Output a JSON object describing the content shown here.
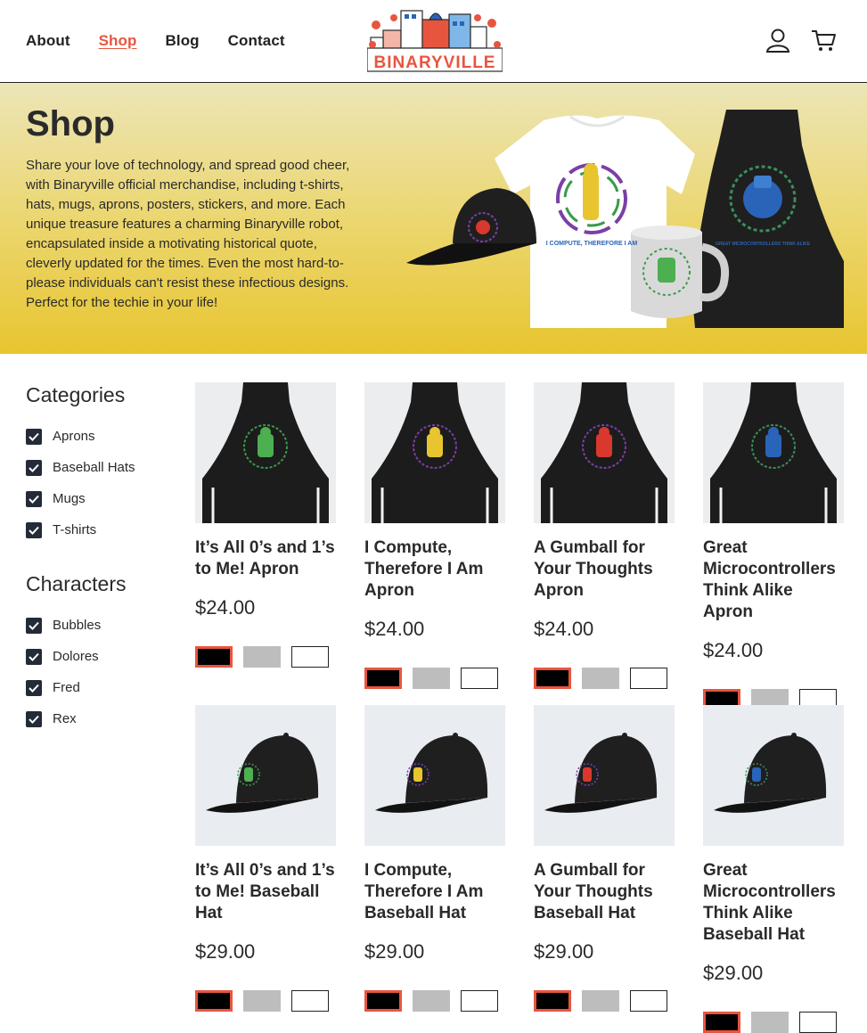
{
  "header": {
    "nav": [
      "About",
      "Shop",
      "Blog",
      "Contact"
    ],
    "active_nav": "Shop",
    "logo_text": "BINARYVILLE",
    "icons": [
      "user-icon",
      "cart-icon"
    ]
  },
  "hero": {
    "title": "Shop",
    "description": "Share your love of technology, and spread good cheer, with Binaryville official merchandise, including t-shirts, hats, mugs, aprons, posters, stickers, and more. Each unique treasure features a charming Binaryville robot, encapsulated inside a motivating historical quote, cleverly updated for the times. Even the most hard-to-please individuals can't resist these infectious designs. Perfect for the techie in your life!",
    "shirt_text": "I COMPUTE, THEREFORE I AM",
    "apron_text": "GREAT MICROCONTROLLERS THINK ALIKE"
  },
  "filters": {
    "categories_title": "Categories",
    "categories": [
      "Aprons",
      "Baseball Hats",
      "Mugs",
      "T-shirts"
    ],
    "characters_title": "Characters",
    "characters": [
      "Bubbles",
      "Dolores",
      "Fred",
      "Rex"
    ]
  },
  "products": [
    {
      "name": "It’s All 0’s and 1’s to Me! Apron",
      "price": "$24.00",
      "type": "apron",
      "robot": "green"
    },
    {
      "name": "I Compute, Therefore I Am Apron",
      "price": "$24.00",
      "type": "apron",
      "robot": "yellow"
    },
    {
      "name": "A Gumball for Your Thoughts Apron",
      "price": "$24.00",
      "type": "apron",
      "robot": "red"
    },
    {
      "name": "Great Microcontrollers Think Alike Apron",
      "price": "$24.00",
      "type": "apron",
      "robot": "blue"
    },
    {
      "name": "It’s All 0’s and 1’s to Me! Baseball Hat",
      "price": "$29.00",
      "type": "hat",
      "robot": "green"
    },
    {
      "name": "I Compute, Therefore I Am Baseball Hat",
      "price": "$29.00",
      "type": "hat",
      "robot": "yellow"
    },
    {
      "name": "A Gumball for Your Thoughts Baseball Hat",
      "price": "$29.00",
      "type": "hat",
      "robot": "red"
    },
    {
      "name": "Great Microcontrollers Think Alike Baseball Hat",
      "price": "$29.00",
      "type": "hat",
      "robot": "blue"
    }
  ],
  "swatch_colors": [
    "black",
    "gray",
    "white"
  ],
  "colors": {
    "accent": "#e8553f",
    "text": "#2a2a2a",
    "checkbox": "#232b38",
    "hero_top": "#ece5b7",
    "hero_bottom": "#e8c52f",
    "robot_green": "#4caf50",
    "robot_yellow": "#e8c52f",
    "robot_red": "#d9382e",
    "robot_blue": "#2a64b8"
  }
}
